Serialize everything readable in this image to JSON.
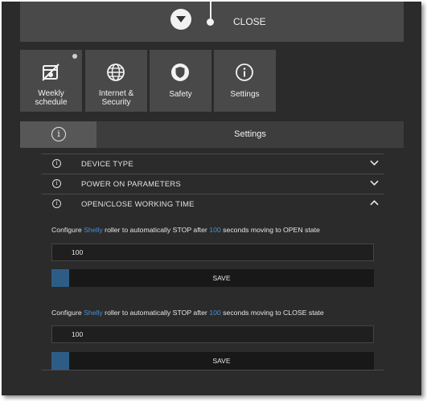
{
  "topbar": {
    "close_label": "CLOSE"
  },
  "tiles": [
    {
      "label_line1": "Weekly",
      "label_line2": "schedule",
      "icon": "calendar-off-icon"
    },
    {
      "label_line1": "Internet &",
      "label_line2": "Security",
      "icon": "globe-icon"
    },
    {
      "label_line1": "Safety",
      "icon": "shield-icon"
    },
    {
      "label_line1": "Settings",
      "icon": "info-icon"
    }
  ],
  "panel": {
    "title": "Settings",
    "info_glyph": "i"
  },
  "sections": [
    {
      "label": "DEVICE TYPE",
      "state": "collapsed"
    },
    {
      "label": "POWER ON PARAMETERS",
      "state": "collapsed"
    },
    {
      "label": "OPEN/CLOSE WORKING TIME",
      "state": "expanded"
    }
  ],
  "open_time": {
    "text_prefix": "Configure ",
    "brand": "Shelly",
    "text_middle": " roller to automatically STOP after ",
    "seconds": "100",
    "text_suffix": " seconds moving to OPEN state",
    "value": "100",
    "save_label": "SAVE"
  },
  "close_time": {
    "text_prefix": "Configure ",
    "brand": "Shelly",
    "text_middle": " roller to automatically STOP after ",
    "seconds": "100",
    "text_suffix": " seconds moving to CLOSE state",
    "value": "100",
    "save_label": "SAVE"
  },
  "colors": {
    "accent_blue": "#4a8fd0",
    "save_square": "#2d5d86",
    "background": "#2b2b2b",
    "tile": "#494949"
  }
}
